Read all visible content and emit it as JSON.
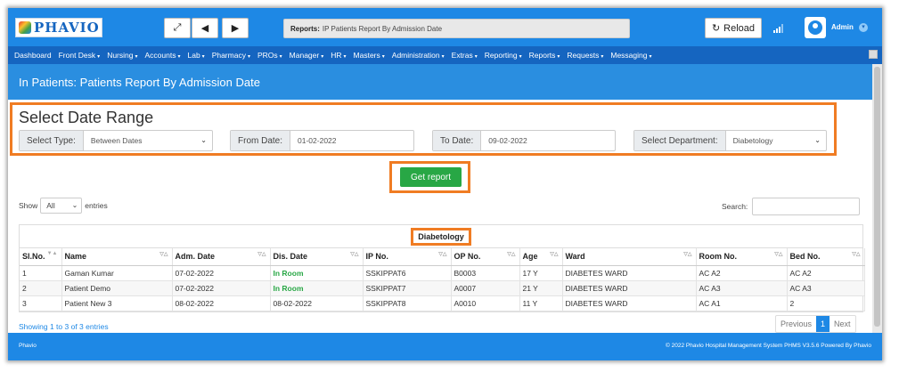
{
  "header": {
    "logo_text": "PHAVIO",
    "report_prefix": "Reports:",
    "report_title": "IP Patients Report By Admission Date",
    "reload_label": "Reload",
    "user_name": "Admin"
  },
  "nav": {
    "items": [
      "Dashboard",
      "Front Desk",
      "Nursing",
      "Accounts",
      "Lab",
      "Pharmacy",
      "PROs",
      "Manager",
      "HR",
      "Masters",
      "Administration",
      "Extras",
      "Reporting",
      "Reports",
      "Requests",
      "Messaging"
    ],
    "caret": "▾"
  },
  "page": {
    "title": "In Patients: Patients Report By Admission Date"
  },
  "filters": {
    "section_title": "Select Date Range",
    "select_type_label": "Select Type:",
    "select_type_value": "Between Dates",
    "from_date_label": "From Date:",
    "from_date_value": "01-02-2022",
    "to_date_label": "To Date:",
    "to_date_value": "09-02-2022",
    "department_label": "Select Department:",
    "department_value": "Diabetology",
    "get_report_label": "Get report"
  },
  "table_controls": {
    "show_label": "Show",
    "show_value": "All",
    "entries_label": "entries",
    "search_label": "Search:"
  },
  "table": {
    "caption": "Diabetology",
    "columns": [
      "Sl.No.",
      "Name",
      "Adm. Date",
      "Dis. Date",
      "IP No.",
      "OP No.",
      "Age",
      "Ward",
      "Room No.",
      "Bed No."
    ],
    "rows": [
      [
        "1",
        "Gaman Kumar",
        "07-02-2022",
        "In Room",
        "SSKIPPAT6",
        "B0003",
        "17 Y",
        "DIABETES WARD",
        "AC A2",
        "AC A2"
      ],
      [
        "2",
        "Patient Demo",
        "07-02-2022",
        "In Room",
        "SSKIPPAT7",
        "A0007",
        "21 Y",
        "DIABETES WARD",
        "AC A3",
        "AC A3"
      ],
      [
        "3",
        "Patient New 3",
        "08-02-2022",
        "08-02-2022",
        "SSKIPPAT8",
        "A0010",
        "11 Y",
        "DIABETES WARD",
        "AC A1",
        "2"
      ]
    ],
    "info": "Showing 1 to 3 of 3 entries",
    "pager": {
      "previous": "Previous",
      "page": "1",
      "next": "Next"
    }
  },
  "footer": {
    "left": "Phavio",
    "right": "© 2022 Phavio Hospital Management System PHMS V3.5.6 Powered By Phavio"
  },
  "colors": {
    "primary": "#1e88e5",
    "nav": "#1565c0",
    "highlight": "#f07c23",
    "success": "#28a745"
  },
  "icons": {
    "fullscreen": "fullscreen-icon",
    "back": "arrow-left-icon",
    "forward": "arrow-right-icon",
    "reload": "reload-icon",
    "signal": "signal-icon",
    "user": "user-icon"
  }
}
